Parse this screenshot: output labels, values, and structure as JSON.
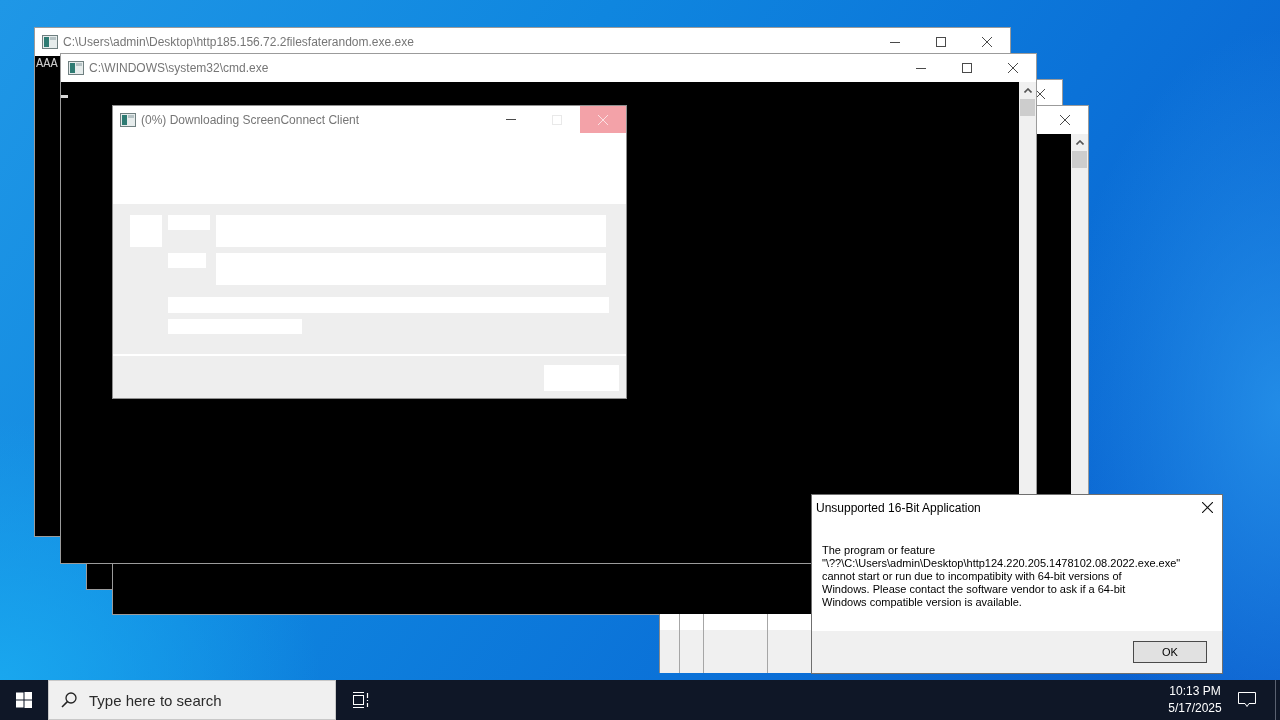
{
  "consoles": [
    {
      "title": "C:\\Users\\admin\\Desktop\\http185.156.72.2filesfaterandom.exe.exe",
      "active": false,
      "output": "AAA",
      "cursor": false
    },
    {
      "title": "C:\\WINDOWS\\system32\\cmd.exe",
      "active": false,
      "cursor": true
    }
  ],
  "download_dialog": {
    "title": "(0%) Downloading ScreenConnect Client",
    "active": false,
    "maximize_disabled": true,
    "close_highlighted": true
  },
  "error_dialog": {
    "title": "Unsupported 16-Bit Application",
    "active": true,
    "message_lines": [
      "The program or feature",
      "\"\\??\\C:\\Users\\admin\\Desktop\\http124.220.205.1478102.08.2022.exe.exe\"",
      "cannot start or run due to incompatibity with 64-bit versions of",
      "Windows. Please contact the software vendor to ask if a 64-bit",
      "Windows compatible version is available."
    ],
    "button": "OK"
  },
  "taskbar": {
    "search": {
      "placeholder": "Type here to search"
    },
    "clock": {
      "time": "10:13 PM",
      "date": "5/17/2025"
    }
  }
}
